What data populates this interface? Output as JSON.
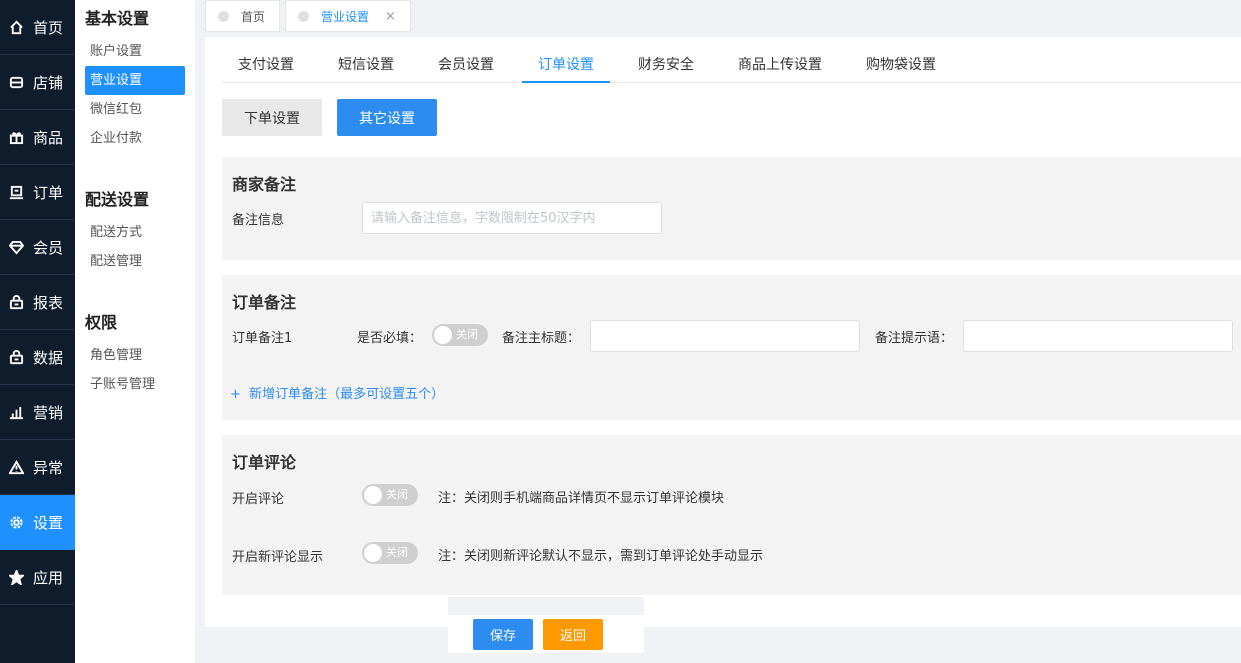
{
  "leftnav": {
    "items": [
      {
        "label": "首页",
        "icon": "home-icon"
      },
      {
        "label": "店铺",
        "icon": "store-icon"
      },
      {
        "label": "商品",
        "icon": "gift-icon"
      },
      {
        "label": "订单",
        "icon": "order-icon"
      },
      {
        "label": "会员",
        "icon": "diamond-icon"
      },
      {
        "label": "报表",
        "icon": "bag-icon"
      },
      {
        "label": "数据",
        "icon": "bag-icon"
      },
      {
        "label": "营销",
        "icon": "bar-chart-icon"
      },
      {
        "label": "异常",
        "icon": "warning-icon"
      },
      {
        "label": "设置",
        "icon": "gear-icon"
      },
      {
        "label": "应用",
        "icon": "star-icon"
      }
    ],
    "active_index": 9
  },
  "submenu": {
    "groups": [
      {
        "title": "基本设置",
        "items": [
          "账户设置",
          "营业设置",
          "微信红包",
          "企业付款"
        ]
      },
      {
        "title": "配送设置",
        "items": [
          "配送方式",
          "配送管理"
        ]
      },
      {
        "title": "权限",
        "items": [
          "角色管理",
          "子账号管理"
        ]
      }
    ],
    "active_item": "营业设置"
  },
  "tabs": {
    "items": [
      {
        "label": "首页"
      },
      {
        "label": "营业设置",
        "close": "×"
      }
    ]
  },
  "subtabs": [
    "支付设置",
    "短信设置",
    "会员设置",
    "订单设置",
    "财务安全",
    "商品上传设置",
    "购物袋设置"
  ],
  "subtab_active": "订单设置",
  "mode_buttons": {
    "order_settings": "下单设置",
    "other_settings": "其它设置"
  },
  "merchant_note": {
    "title": "商家备注",
    "label": "备注信息",
    "placeholder": "请输入备注信息，字数限制在50汉字内"
  },
  "order_note": {
    "title": "订单备注",
    "row_label": "订单备注1",
    "required_label": "是否必填：",
    "toggle_state": "关闭",
    "main_title_label": "备注主标题：",
    "hint_label": "备注提示语：",
    "add_link": "新增订单备注（最多可设置五个）",
    "add_icon": "+"
  },
  "order_review": {
    "title": "订单评论",
    "enable_label": "开启评论",
    "enable_toggle": "关闭",
    "enable_note": "注：关闭则手机端商品详情页不显示订单评论模块",
    "new_label": "开启新评论显示",
    "new_toggle": "关闭",
    "new_note": "注：关闭则新评论默认不显示，需到订单评论处手动显示"
  },
  "footer": {
    "save": "保存",
    "back": "返回"
  },
  "colors": {
    "primary": "#2d8cf0",
    "nav_bg": "#0f1c2c",
    "active_nav": "#1e90ff",
    "back_button": "#ff9900"
  }
}
